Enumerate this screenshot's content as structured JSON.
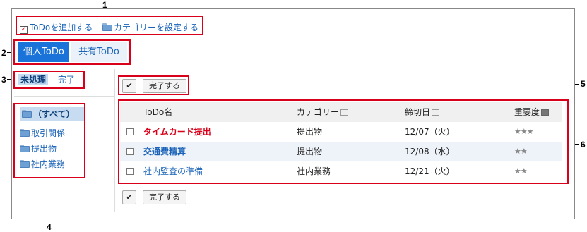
{
  "callouts": [
    "1",
    "2",
    "3",
    "4",
    "5",
    "6"
  ],
  "toolbar": {
    "add_todo": "ToDoを追加する",
    "set_category": "カテゴリーを設定する"
  },
  "tabs": {
    "personal": "個人ToDo",
    "shared": "共有ToDo"
  },
  "filters": {
    "pending": "未処理",
    "done": "完了"
  },
  "categories": {
    "all": "（すべて）",
    "items": [
      "取引関係",
      "提出物",
      "社内業務"
    ]
  },
  "actions": {
    "check_glyph": "✔",
    "complete_label": "完了する"
  },
  "table": {
    "headers": {
      "name": "ToDo名",
      "category": "カテゴリー",
      "due": "締切日",
      "priority": "重要度"
    },
    "rows": [
      {
        "name": "タイムカード提出",
        "category": "提出物",
        "due": "12/07（火）",
        "priority": "★★★",
        "name_color": "#d9001b"
      },
      {
        "name": "交通費精算",
        "category": "提出物",
        "due": "12/08（水）",
        "priority": "★★",
        "name_color": "#1a63b8"
      },
      {
        "name": "社内監査の準備",
        "category": "社内業務",
        "due": "12/21（火）",
        "priority": "★★",
        "name_color": "#1a63b8"
      }
    ]
  },
  "colors": {
    "accent_blue": "#1a63b8",
    "callout_red": "#d9001b",
    "active_tab": "#1a73d9",
    "selected_bg": "#c7dcf0",
    "row_alt": "#eef3fa"
  }
}
